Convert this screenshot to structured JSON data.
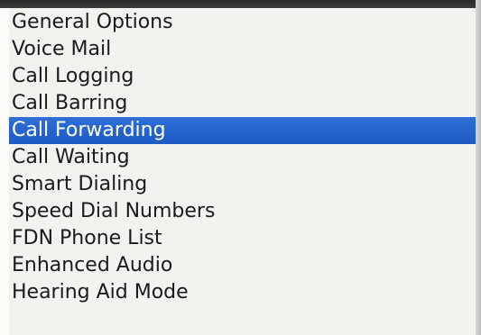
{
  "menu": {
    "items": [
      {
        "label": "General Options"
      },
      {
        "label": "Voice Mail"
      },
      {
        "label": "Call Logging"
      },
      {
        "label": "Call Barring"
      },
      {
        "label": "Call Forwarding"
      },
      {
        "label": "Call Waiting"
      },
      {
        "label": "Smart Dialing"
      },
      {
        "label": "Speed Dial Numbers"
      },
      {
        "label": "FDN Phone List"
      },
      {
        "label": "Enhanced Audio"
      },
      {
        "label": "Hearing Aid Mode"
      }
    ],
    "selected_label": "Call Forwarding"
  },
  "colors": {
    "highlight": "#1e59c4",
    "background": "#f3f2ee",
    "text": "#1a1a1a"
  }
}
